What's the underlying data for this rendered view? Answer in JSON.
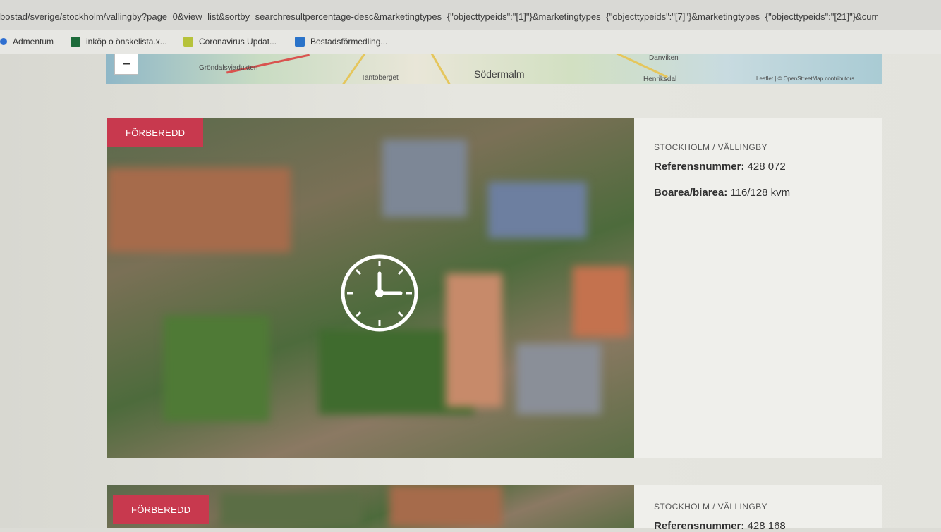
{
  "browser": {
    "url": "bostad/sverige/stockholm/vallingby?page=0&view=list&sortby=searchresultpercentage-desc&marketingtypes={\"objecttypeids\":\"[1]\"}&marketingtypes={\"objecttypeids\":\"[7]\"}&marketingtypes={\"objecttypeids\":\"[21]\"}&curr",
    "bookmarks": [
      {
        "label": "Admentum",
        "icon": "admentum-icon"
      },
      {
        "label": "inköp o önskelista.x...",
        "icon": "excel-icon"
      },
      {
        "label": "Coronavirus Updat...",
        "icon": "worldometer-icon"
      },
      {
        "label": "Bostadsförmedling...",
        "icon": "bostad-icon"
      }
    ]
  },
  "map": {
    "zoom_out_label": "−",
    "labels": [
      "Gröndalsviadukten",
      "Tantoberget",
      "Södermalm",
      "Danviken",
      "Henriksdal"
    ],
    "attribution": "Leaflet | © OpenStreetMap contributors"
  },
  "listings": [
    {
      "badge": "FÖRBEREDD",
      "location": "STOCKHOLM / VÄLLINGBY",
      "ref_label": "Referensnummer:",
      "ref_value": "428 072",
      "area_label": "Boarea/biarea:",
      "area_value": "116/128 kvm"
    },
    {
      "badge": "FÖRBEREDD",
      "location": "STOCKHOLM / VÄLLINGBY",
      "ref_label": "Referensnummer:",
      "ref_value": "428 168"
    }
  ],
  "colors": {
    "badge": "#c8394e",
    "card_bg": "#efefeb",
    "page_bg": "#e3e3dd"
  }
}
